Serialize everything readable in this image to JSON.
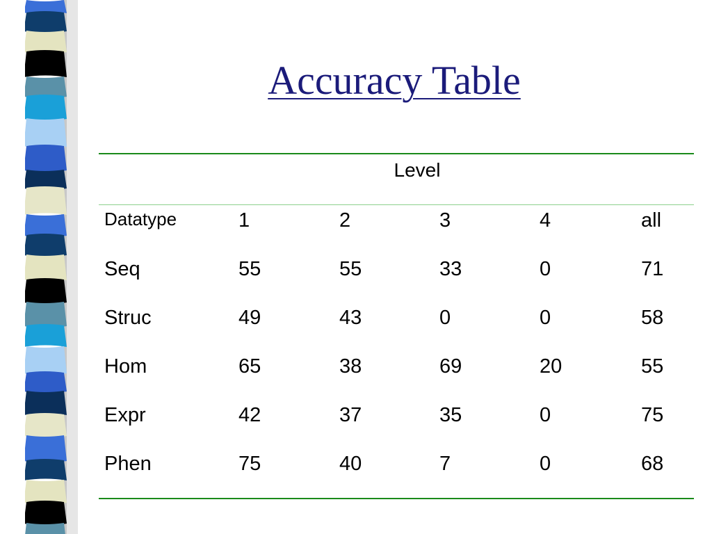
{
  "slide": {
    "title": "Accuracy Table"
  },
  "table": {
    "group_header": "Level",
    "columns": [
      "Datatype",
      "1",
      "2",
      "3",
      "4",
      "all"
    ],
    "rows": [
      [
        "Seq",
        "55",
        "55",
        "33",
        "0",
        "71"
      ],
      [
        "Struc",
        "49",
        "43",
        "0",
        "0",
        "58"
      ],
      [
        "Hom",
        "65",
        "38",
        "69",
        "20",
        "55"
      ],
      [
        "Expr",
        "42",
        "37",
        "35",
        "0",
        "75"
      ],
      [
        "Phen",
        "75",
        "40",
        "7",
        "0",
        "68"
      ]
    ]
  },
  "decoration": {
    "stripe_colors": [
      "#3a6fd8",
      "#0f3d6b",
      "#e4e4c0",
      "#000000",
      "#5a91a8",
      "#1aa0d8",
      "#a8d0f4",
      "#2e5cc8",
      "#0b2f5a",
      "#e6e6c8"
    ]
  }
}
